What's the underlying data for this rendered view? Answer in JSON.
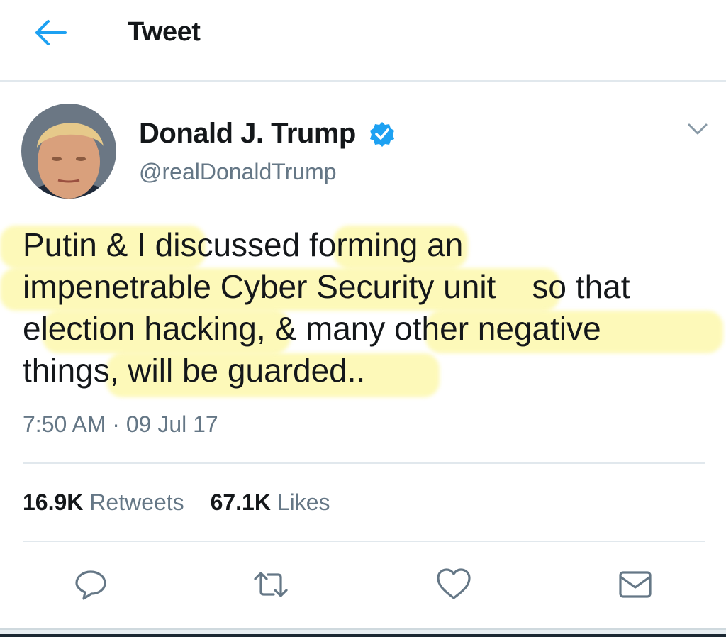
{
  "header": {
    "title": "Tweet",
    "back_icon": "arrow-left-icon"
  },
  "tweet": {
    "author": {
      "display_name": "Donald J. Trump",
      "handle": "@realDonaldTrump",
      "verified": true,
      "verified_icon": "verified-badge-icon"
    },
    "text_lines": [
      "Putin & I discussed forming an",
      "impenetrable Cyber Security unit    so that",
      "election hacking, & many other negative",
      "things, will be guarded.."
    ],
    "timestamp": "7:50 AM · 09 Jul 17",
    "stats": {
      "retweets_count": "16.9K",
      "retweets_label": "Retweets",
      "likes_count": "67.1K",
      "likes_label": "Likes"
    },
    "actions": [
      {
        "name": "reply",
        "icon": "reply-icon"
      },
      {
        "name": "retweet",
        "icon": "retweet-icon"
      },
      {
        "name": "like",
        "icon": "heart-icon"
      },
      {
        "name": "share",
        "icon": "mail-icon"
      }
    ]
  },
  "colors": {
    "accent": "#1da1f2",
    "text_primary": "#14171a",
    "text_secondary": "#657786",
    "divider": "#e1e8ed",
    "highlight": "#faf046"
  }
}
